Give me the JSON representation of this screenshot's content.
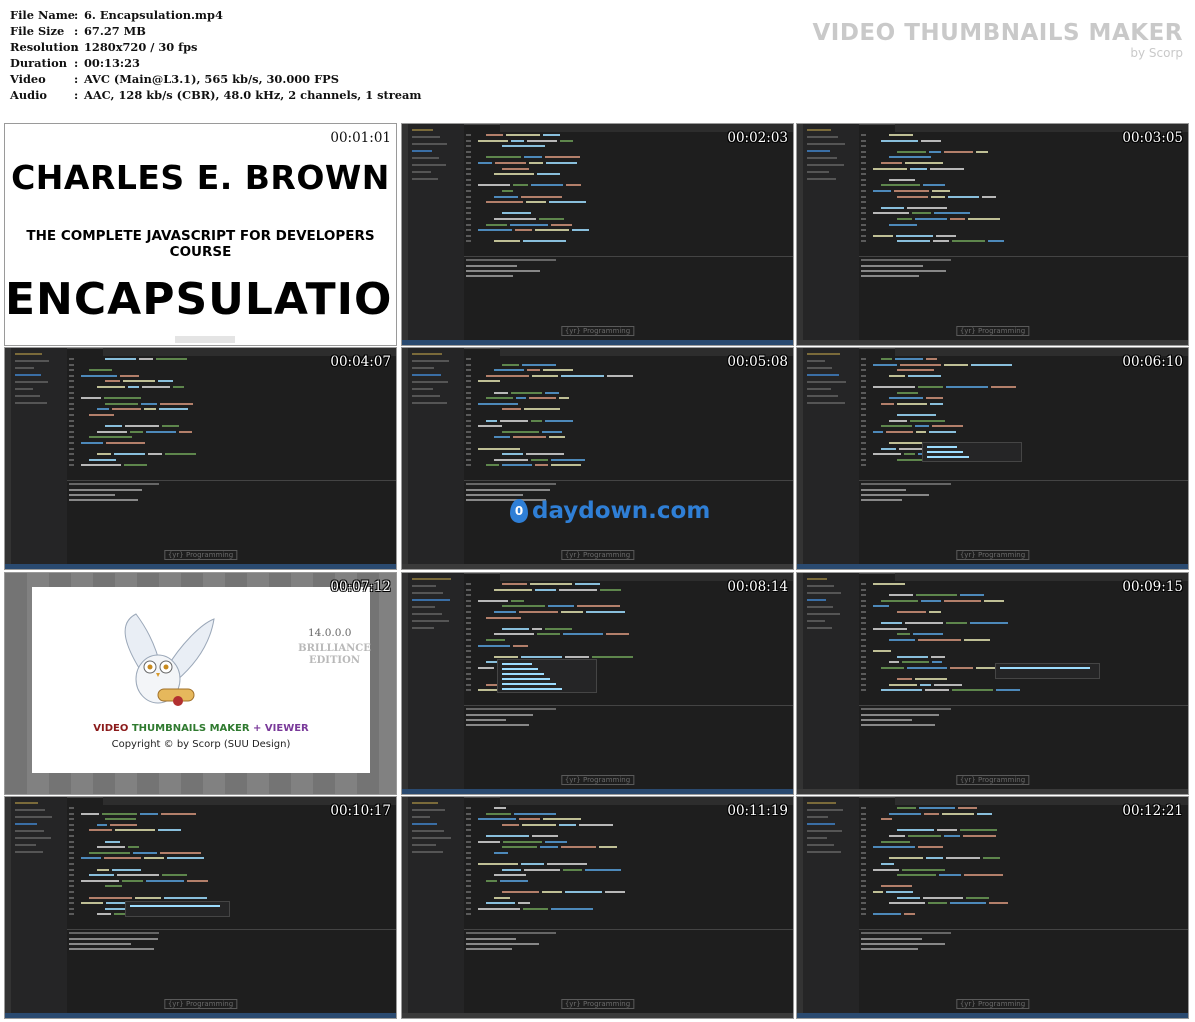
{
  "file_info": {
    "rows": [
      {
        "key": "File Name",
        "sep": ":",
        "value": "6. Encapsulation.mp4"
      },
      {
        "key": "File Size",
        "sep": ":",
        "value": "67.27 MB"
      },
      {
        "key": "Resolution",
        "sep": ":",
        "value": "1280x720 / 30 fps"
      },
      {
        "key": "Duration",
        "sep": ":",
        "value": "00:13:23"
      },
      {
        "key": "Video",
        "sep": ":",
        "value": "AVC (Main@L3.1), 565 kb/s, 30.000 FPS"
      },
      {
        "key": "Audio",
        "sep": ":",
        "value": "AAC, 128 kb/s (CBR), 48.0 kHz, 2 channels, 1 stream"
      }
    ]
  },
  "branding": {
    "title": "VIDEO THUMBNAILS MAKER",
    "subtitle": "by Scorp"
  },
  "thumbnails": [
    {
      "timestamp": "00:01:01",
      "kind": "title"
    },
    {
      "timestamp": "00:02:03",
      "kind": "ide"
    },
    {
      "timestamp": "00:03:05",
      "kind": "ide"
    },
    {
      "timestamp": "00:04:07",
      "kind": "ide"
    },
    {
      "timestamp": "00:05:08",
      "kind": "ide"
    },
    {
      "timestamp": "00:06:10",
      "kind": "ide"
    },
    {
      "timestamp": "00:07:12",
      "kind": "splash"
    },
    {
      "timestamp": "00:08:14",
      "kind": "ide"
    },
    {
      "timestamp": "00:09:15",
      "kind": "ide"
    },
    {
      "timestamp": "00:10:17",
      "kind": "ide"
    },
    {
      "timestamp": "00:11:19",
      "kind": "ide"
    },
    {
      "timestamp": "00:12:21",
      "kind": "ide"
    }
  ],
  "title_card": {
    "author": "CHARLES E. BROWN",
    "course": "THE COMPLETE JAVASCRIPT FOR DEVELOPERS COURSE",
    "topic": "ENCAPSULATION"
  },
  "splash": {
    "version": "14.0.0.0",
    "edition": "BRILLIANCE EDITION",
    "title_part1": "VIDEO ",
    "title_part2": "THUMBNAILS MAKER",
    "title_part3": " + VIEWER",
    "copyright": "Copyright © by Scorp (SUU Design)"
  },
  "ide_watermark": "{yr} Programming",
  "overlay_watermark": {
    "icon_text": "0",
    "text": "daydown.com"
  },
  "colors": {
    "background": "#ffffff",
    "ide_bg": "#1e1e1e",
    "sidebar": "#252526",
    "keyword": "#569cd6",
    "string": "#ce9178",
    "function": "#dcdcaa",
    "variable": "#9cdcfe"
  }
}
